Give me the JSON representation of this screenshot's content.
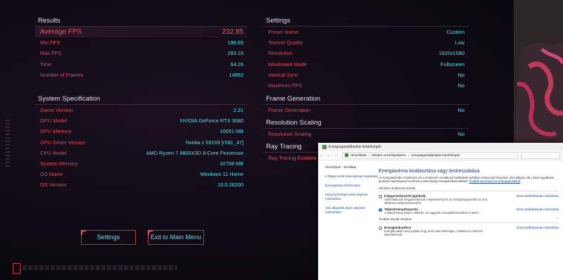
{
  "results": {
    "title": "Results",
    "rows": [
      {
        "label": "Average FPS",
        "value": "232.85"
      },
      {
        "label": "Min FPS",
        "value": "196.65"
      },
      {
        "label": "Max FPS",
        "value": "283.19"
      },
      {
        "label": "Time",
        "value": "64.26"
      },
      {
        "label": "Number of Frames",
        "value": "14962"
      }
    ]
  },
  "system": {
    "title": "System Specification",
    "rows": [
      {
        "label": "Game Version",
        "value": "2.31"
      },
      {
        "label": "GPU Model",
        "value": "NVIDIA GeForce RTX 3080"
      },
      {
        "label": "GPU Memory",
        "value": "10051 MB"
      },
      {
        "label": "GPU Driver Version",
        "value": "Nvidia v 59159 [r591_47]"
      },
      {
        "label": "CPU Model",
        "value": "AMD Ryzen 7 9800X3D 8-Core Processor"
      },
      {
        "label": "System Memory",
        "value": "32768 MB"
      },
      {
        "label": "OS Name",
        "value": "Windows 11 Home"
      },
      {
        "label": "OS Version",
        "value": "10.0.26200"
      }
    ]
  },
  "settings": {
    "title": "Settings",
    "rows": [
      {
        "label": "Preset Name",
        "value": "Custom"
      },
      {
        "label": "Texture Quality",
        "value": "Low"
      },
      {
        "label": "Resolution",
        "value": "1920x1080"
      },
      {
        "label": "Windowed Mode",
        "value": "Fullscreen"
      },
      {
        "label": "Vertical Sync",
        "value": "No"
      },
      {
        "label": "Maximum FPS",
        "value": "No"
      }
    ]
  },
  "frame_generation": {
    "title": "Frame Generation",
    "label": "Frame Generation",
    "value": "No"
  },
  "resolution_scaling": {
    "title": "Resolution Scaling",
    "label": "Resolution Scaling",
    "value": "No"
  },
  "ray_tracing": {
    "title": "Ray Tracing",
    "label": "Ray Tracing Enabled"
  },
  "buttons": {
    "settings": "Settings",
    "exit": "Exit to Main Menu"
  },
  "windows_dialog": {
    "title": "Energiagazdálkodási lehetőségek",
    "breadcrumb": [
      "Vezérlőpult",
      "Minden vezérlőpultelem",
      "Energiagazdálkodási lehetőségek"
    ],
    "sidebar": [
      {
        "label": "Vezérlőpult – kezdőlap",
        "plain": true
      },
      {
        "label": "A főkapcsolók funkciójának megadása"
      },
      {
        "label": "Energiaséma létrehozása"
      },
      {
        "label": "Képernyő-kikapcsolás idejének módosítása"
      },
      {
        "label": "Alvó állapotba lépés idejének módosítása"
      }
    ],
    "heading": "Energiaséma kiválasztása vagy testreszabása",
    "intro": "Az energiasémák a hardveres és a rendszerre vonatkozó beállítások (például a képernyő fényereje, alvó állapot, stb.) olyan együttesei, amelyek segítségével kezelheti a számítógép energiafelhasználását.",
    "intro_link": "További információ az energiasémákról",
    "section_selected": "Sémáim rendszeritt sémák",
    "plans": [
      {
        "name": "Kiegyensúlyozott (ajánlott)",
        "desc": "Automatikusan kiegyensúlyozza a teljesítményt és az energiafogyasztást az arra alkalmas hardvereszközökön.",
        "link": "Séma beállításainak módosítása",
        "selected": false
      },
      {
        "name": "Teljesítményközpontú",
        "desc": "A teljesítményt helyezi előtérbe, de nagyobb energiafelhasználást is jelent.",
        "link": "Séma beállításainak módosítása",
        "selected": true
      }
    ],
    "section_more": "További sémák elrejtése",
    "more_plans": [
      {
        "name": "Energiatakarékos",
        "desc": "Energiát takarít meg azáltal, hogy ahol csak lehetséges, csökkenti a rendszer teljesítményét.",
        "link": "Séma beállításainak módosítása",
        "selected": false
      }
    ]
  }
}
